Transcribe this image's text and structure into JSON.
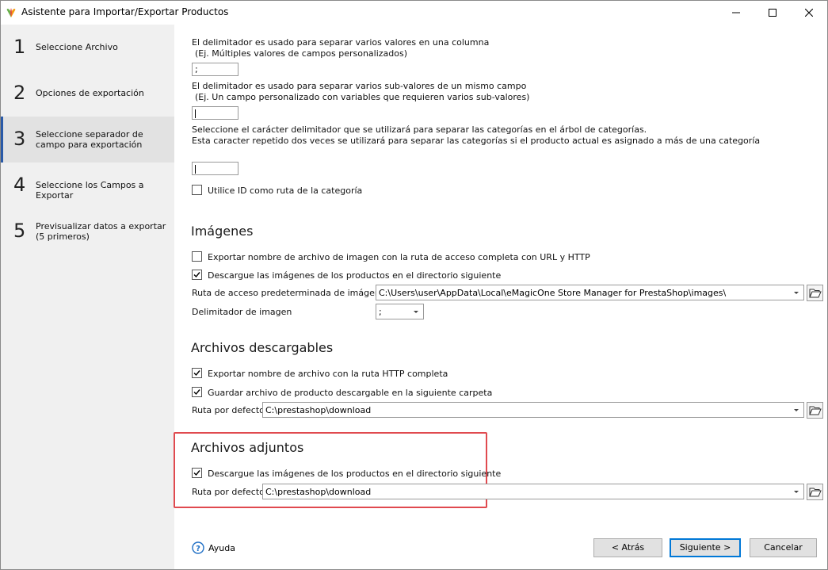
{
  "window": {
    "title": "Asistente para Importar/Exportar Productos"
  },
  "sidebar": {
    "steps": [
      {
        "num": "1",
        "label": "Seleccione Archivo"
      },
      {
        "num": "2",
        "label": "Opciones de exportación"
      },
      {
        "num": "3",
        "label": "Seleccione separador de campo para exportación",
        "active": true
      },
      {
        "num": "4",
        "label": "Seleccione los Campos a Exportar"
      },
      {
        "num": "5",
        "label": "Previsualizar datos a exportar (5 primeros)"
      }
    ]
  },
  "delimiters": {
    "multi_value_line1": "El delimitador es usado para separar varios valores en una columna",
    "multi_value_line2": "(Ej. Múltiples valores de campos personalizados)",
    "multi_value_input": ";",
    "sub_value_line1": "El delimitador es usado para separar varios sub-valores de un mismo campo",
    "sub_value_line2": "(Ej. Un campo personalizado con variables que requieren varios sub-valores)",
    "sub_value_input": "",
    "category_line1": "Seleccione el carácter delimitador que se utilizará para separar las categorías en el árbol de categorías.",
    "category_line2": "Esta caracter repetido dos veces se utilizará para separar las categorías si el producto actual es asignado a más de una categoría",
    "category_input": "",
    "use_id_label": "Utilice ID como ruta de la categoría",
    "use_id_checked": false
  },
  "images": {
    "heading": "Imágenes",
    "export_full_path_label": "Exportar nombre de archivo de imagen con la ruta de acceso completa con URL y HTTP",
    "export_full_path_checked": false,
    "download_label": "Descargue las imágenes de los productos en el directorio siguiente",
    "download_checked": true,
    "default_path_label": "Ruta de acceso predeterminada de imágenes",
    "default_path_value": "C:\\Users\\user\\AppData\\Local\\eMagicOne Store Manager for PrestaShop\\images\\",
    "delimiter_label": "Delimitador de imagen",
    "delimiter_value": ";"
  },
  "downloadables": {
    "heading": "Archivos descargables",
    "export_http_label": "Exportar nombre de archivo con la ruta HTTP completa",
    "export_http_checked": true,
    "save_label": "Guardar archivo de producto descargable en la siguiente carpeta",
    "save_checked": true,
    "default_path_label": "Ruta por defecto",
    "default_path_value": "C:\\prestashop\\download"
  },
  "attachments": {
    "heading": "Archivos adjuntos",
    "download_label": "Descargue las imágenes de los productos en el directorio siguiente",
    "download_checked": true,
    "default_path_label": "Ruta por defecto",
    "default_path_value": "C:\\prestashop\\download"
  },
  "footer": {
    "help_label": "Ayuda",
    "back_label": "< Atrás",
    "next_label": "Siguiente >",
    "cancel_label": "Cancelar"
  },
  "colors": {
    "highlight_border": "#e04a4f",
    "sidebar_bg": "#f0f0f0",
    "active_step_bg": "#e2e2e2",
    "help_icon": "#1f6fc5"
  },
  "icons": {
    "app": "app-logo-icon",
    "minimize": "minimize-icon",
    "maximize": "maximize-icon",
    "close": "close-icon",
    "dropdown": "chevron-down-icon",
    "folder": "folder-open-icon",
    "help": "help-circle-icon",
    "check": "checkmark-icon"
  }
}
